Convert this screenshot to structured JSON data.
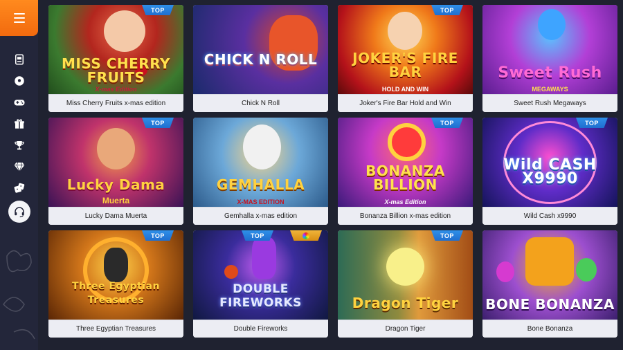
{
  "sidebar": {
    "menu_icon": "hamburger-icon",
    "icons": [
      {
        "name": "slot-machine-icon"
      },
      {
        "name": "soccer-ball-icon"
      },
      {
        "name": "gamepad-icon"
      },
      {
        "name": "gift-icon"
      },
      {
        "name": "trophy-icon"
      },
      {
        "name": "diamond-icon"
      },
      {
        "name": "dice-icon"
      }
    ],
    "support_icon": "headset-icon"
  },
  "colors": {
    "accent": "#f57a16",
    "badge_blue": "#2a83e0",
    "card_bg": "#ecedf3",
    "page_bg": "#1f2230"
  },
  "games": [
    {
      "title": "Miss Cherry Fruits x-mas edition",
      "logo": "MISS CHERRY FRUITS",
      "sub": "X-mas Edition",
      "badge": "TOP"
    },
    {
      "title": "Chick N Roll",
      "logo": "CHICK N ROLL",
      "sub": "",
      "badge": ""
    },
    {
      "title": "Joker's Fire Bar Hold and Win",
      "logo": "JOKER'S FIRE BAR",
      "sub": "HOLD AND WIN",
      "badge": "TOP"
    },
    {
      "title": "Sweet Rush Megaways",
      "logo": "Sweet Rush",
      "sub": "MEGAWAYS",
      "badge": ""
    },
    {
      "title": "Lucky Dama Muerta",
      "logo": "Lucky Dama",
      "sub": "Muerta",
      "badge": "TOP"
    },
    {
      "title": "Gemhalla x-mas edition",
      "logo": "GEMHALLA",
      "sub": "X-MAS EDITION",
      "badge": ""
    },
    {
      "title": "Bonanza Billion x-mas edition",
      "logo": "BONANZA BILLION",
      "sub": "X-mas Edition",
      "badge": "TOP"
    },
    {
      "title": "Wild Cash x9990",
      "logo": "Wild CASH X9990",
      "sub": "",
      "badge": "TOP"
    },
    {
      "title": "Three Egyptian Treasures",
      "logo": "Three Egyptian Treasures",
      "sub": "",
      "badge": "TOP"
    },
    {
      "title": "Double Fireworks",
      "logo": "DOUBLE FIREWORKS",
      "sub": "",
      "badge": "TOP"
    },
    {
      "title": "Dragon Tiger",
      "logo": "Dragon Tiger",
      "sub": "",
      "badge": "TOP"
    },
    {
      "title": "Bone Bonanza",
      "logo": "BONE BONANZA",
      "sub": "",
      "badge": ""
    }
  ]
}
